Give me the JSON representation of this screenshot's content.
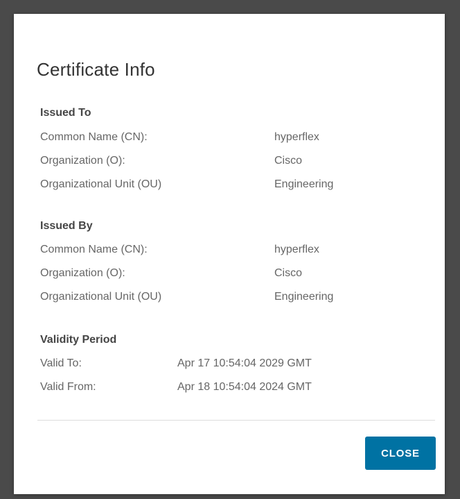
{
  "dialog": {
    "title": "Certificate Info",
    "close_label": "CLOSE"
  },
  "issued_to": {
    "heading": "Issued To",
    "rows": [
      {
        "label": "Common Name (CN):",
        "value": "hyperflex"
      },
      {
        "label": "Organization (O):",
        "value": "Cisco"
      },
      {
        "label": "Organizational Unit (OU)",
        "value": "Engineering"
      }
    ]
  },
  "issued_by": {
    "heading": "Issued By",
    "rows": [
      {
        "label": "Common Name (CN):",
        "value": "hyperflex"
      },
      {
        "label": "Organization (O):",
        "value": "Cisco"
      },
      {
        "label": "Organizational Unit (OU)",
        "value": "Engineering"
      }
    ]
  },
  "validity": {
    "heading": "Validity Period",
    "rows": [
      {
        "label": "Valid To:",
        "value": "Apr 17 10:54:04 2029 GMT"
      },
      {
        "label": "Valid From:",
        "value": "Apr 18 10:54:04 2024 GMT"
      }
    ]
  },
  "colors": {
    "backdrop": "#4a4a4a",
    "dialog_background": "#ffffff",
    "primary_button": "#0072a3",
    "label_text": "#666666",
    "heading_text": "#454545"
  }
}
